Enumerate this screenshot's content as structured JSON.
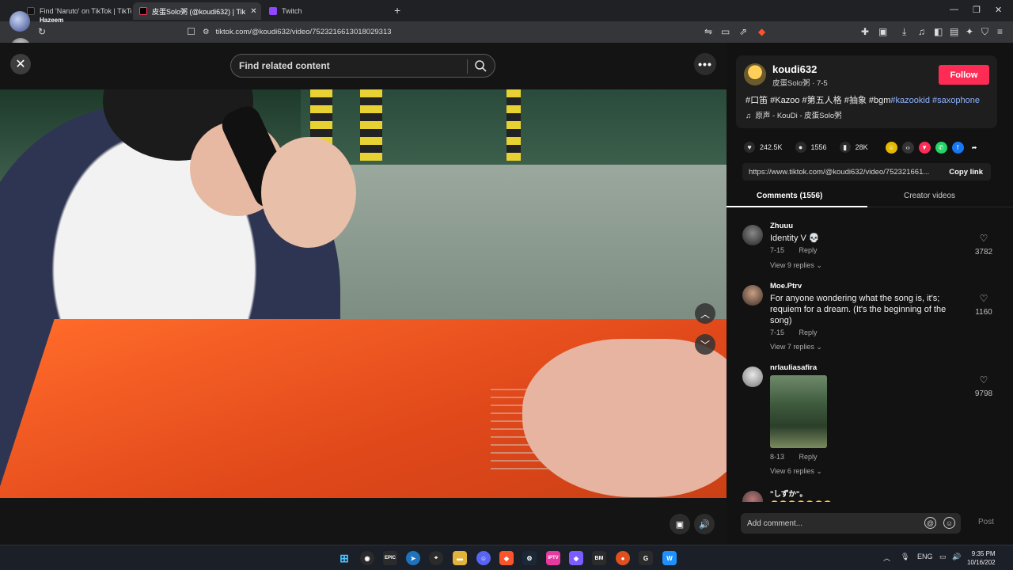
{
  "browser": {
    "tabs": [
      {
        "label": "Find 'Naruto' on TikTok | TikTok Se",
        "active": false
      },
      {
        "label": "皮蛋Solo粥 (@koudi632) | Tik",
        "active": true
      },
      {
        "label": "Twitch",
        "active": false
      }
    ],
    "url": "tiktok.com/@koudi632/video/7523216613018029313"
  },
  "overlay": {
    "user_name": "Hazeem"
  },
  "video": {
    "search_placeholder": "Find related content"
  },
  "author": {
    "name": "koudi632",
    "subtitle": "皮蛋Solo粥 · 7-5",
    "follow_label": "Follow",
    "caption_plain": "#口笛 #Kazoo #第五人格 #抽象 #bgm",
    "caption_highlight": "#kazookid #saxophone",
    "music": "原声 - KouDi - 皮蛋Solo粥"
  },
  "stats": {
    "likes": "242.5K",
    "comments": "1556",
    "saves": "28K"
  },
  "link": {
    "url": "https://www.tiktok.com/@koudi632/video/752321661...",
    "copy_label": "Copy link"
  },
  "tabs": {
    "comments": "Comments (1556)",
    "creator": "Creator videos"
  },
  "comments": [
    {
      "user": "Zhuuu",
      "text": "Identity V 💀",
      "date": "7-15",
      "reply": "Reply",
      "replies": "View 9 replies",
      "likes": "3782"
    },
    {
      "user": "Moe.Ptrv",
      "text": "For anyone wondering what the song is, it's; requiem for a dream. (It's the beginning of the song)",
      "date": "7-15",
      "reply": "Reply",
      "replies": "View 7 replies",
      "likes": "1160"
    },
    {
      "user": "nrlauliasafira",
      "text": "",
      "date": "8-13",
      "reply": "Reply",
      "replies": "View 6 replies",
      "likes": "9798"
    },
    {
      "user": "\"しずか\"。",
      "text": "😂😂😂😂😂😂😂",
      "date": "",
      "reply": "",
      "replies": "",
      "likes": ""
    }
  ],
  "compose": {
    "placeholder": "Add comment...",
    "post_label": "Post"
  },
  "taskbar": {
    "language": "ENG",
    "time": "9:35 PM",
    "date": "10/16/202"
  },
  "colors": {
    "follow": "#fe2c55",
    "hashtag_link": "#8fb3ff"
  }
}
